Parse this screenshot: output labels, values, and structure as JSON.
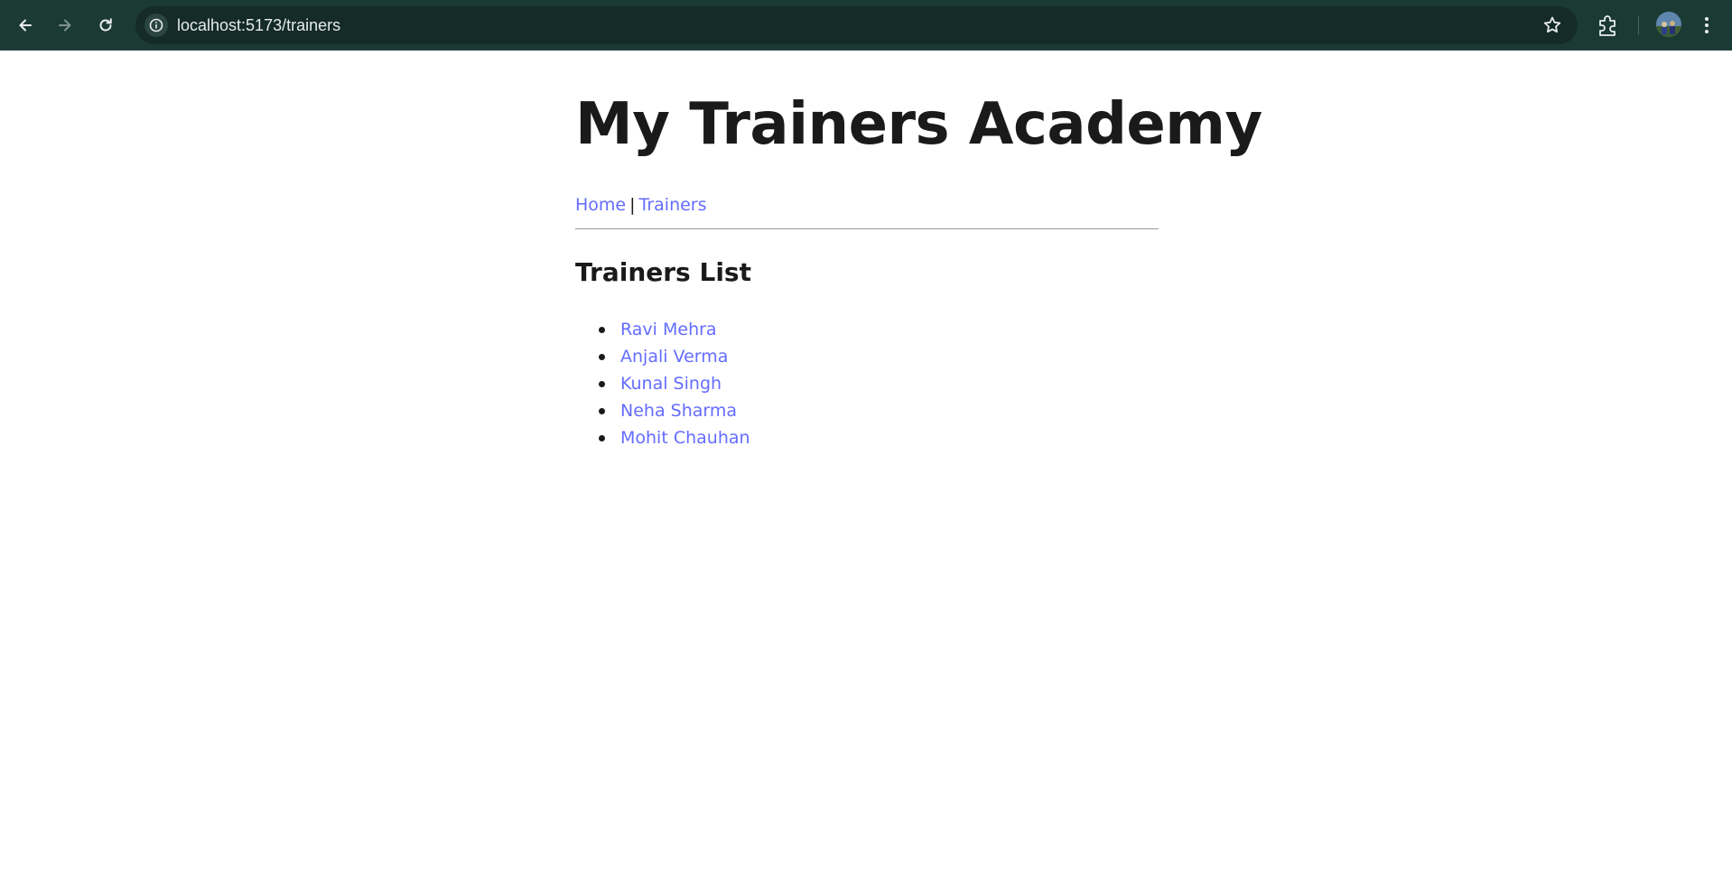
{
  "browser": {
    "url": "localhost:5173/trainers",
    "icons": [
      "back-icon",
      "forward-icon",
      "reload-icon",
      "site-info-icon",
      "bookmark-star-icon",
      "extensions-icon",
      "profile-avatar",
      "menu-icon"
    ]
  },
  "header": {
    "title": "My Trainers Academy"
  },
  "nav": {
    "home_label": "Home",
    "separator": "|",
    "trainers_label": "Trainers"
  },
  "main": {
    "section_title": "Trainers List",
    "trainers": [
      {
        "name": "Ravi Mehra"
      },
      {
        "name": "Anjali Verma"
      },
      {
        "name": "Kunal Singh"
      },
      {
        "name": "Neha Sharma"
      },
      {
        "name": "Mohit Chauhan"
      }
    ]
  },
  "colors": {
    "link": "#646cff",
    "text": "#1a1a1a",
    "browser_chrome": "#1b3a34"
  }
}
